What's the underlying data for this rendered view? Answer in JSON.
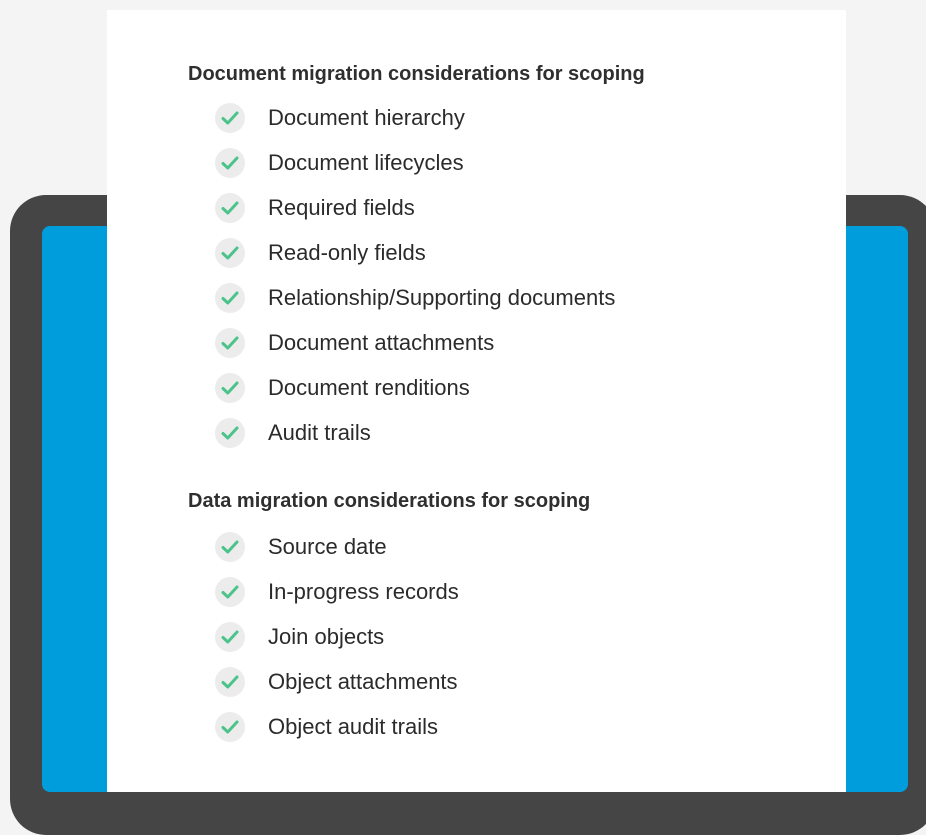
{
  "document_section": {
    "heading": "Document migration considerations for scoping",
    "items": [
      "Document hierarchy",
      "Document lifecycles",
      "Required fields",
      "Read-only fields",
      "Relationship/Supporting documents",
      "Document attachments",
      "Document renditions",
      "Audit trails"
    ]
  },
  "data_section": {
    "heading": "Data migration considerations for scoping",
    "items": [
      "Source date",
      "In-progress records",
      "Join objects",
      "Object attachments",
      "Object audit trails"
    ]
  },
  "icons": {
    "item_marker": "check-circle-icon"
  },
  "colors": {
    "page_background": "#f4f4f4",
    "device_frame": "#454545",
    "device_screen": "#009ddc",
    "card": "#ffffff",
    "check_mark": "#4cc38a",
    "check_background": "#ececec",
    "text": "#2b2b2b"
  }
}
